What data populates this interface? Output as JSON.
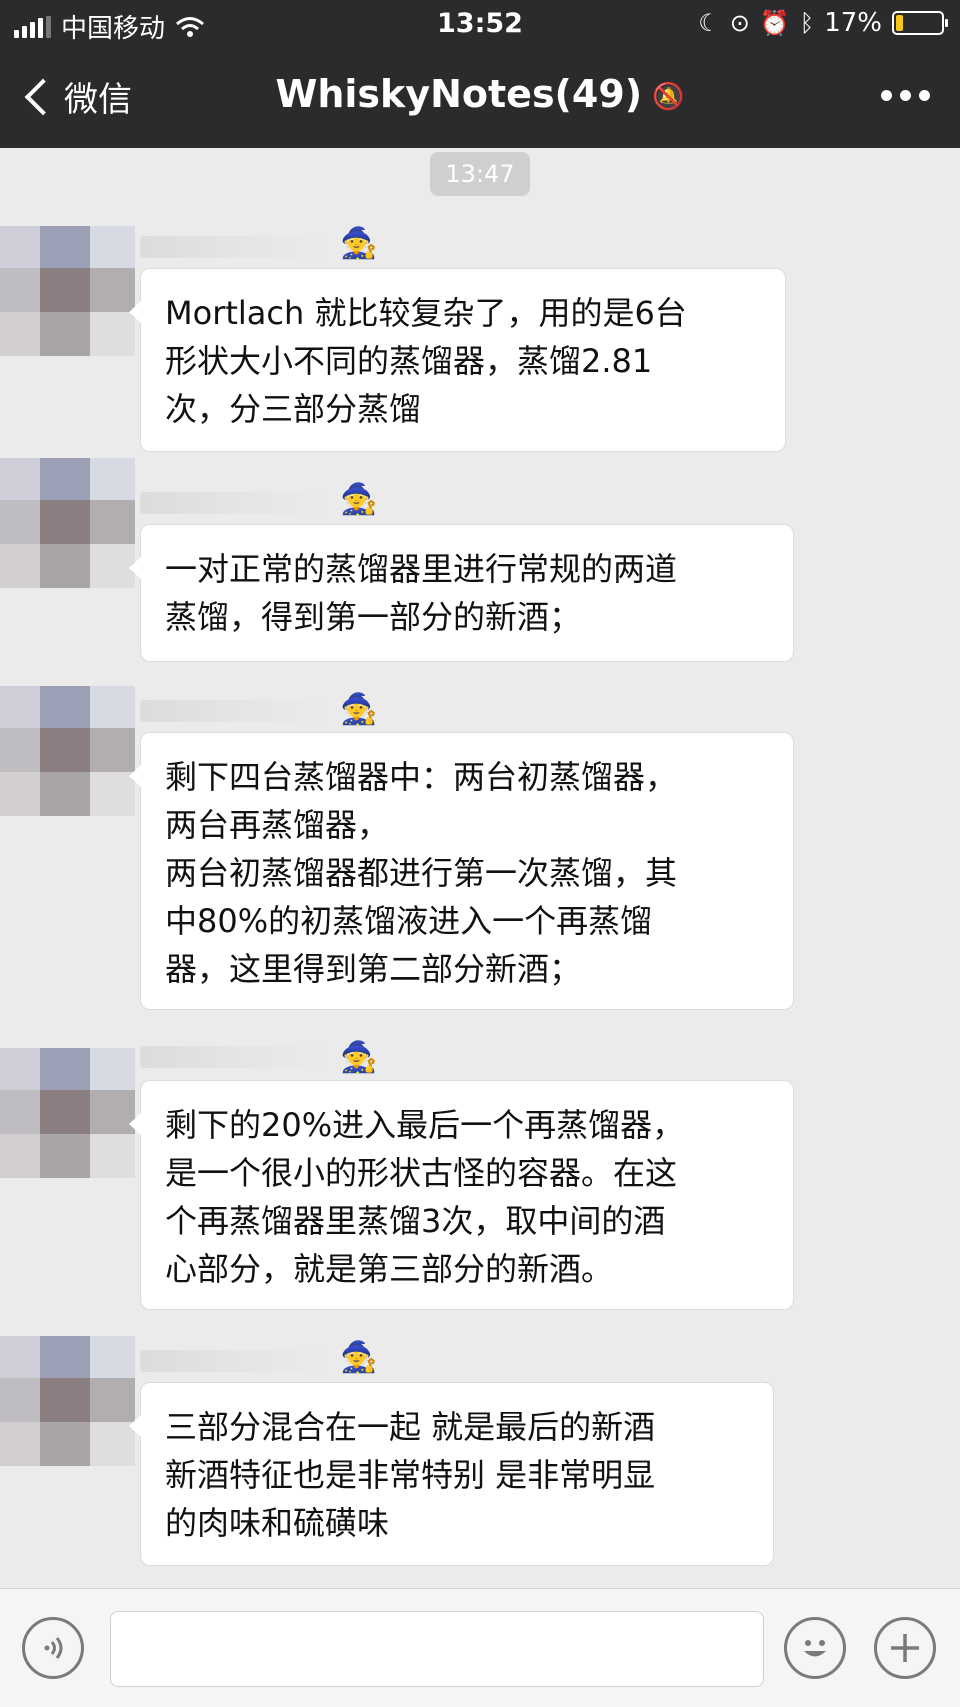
{
  "status_bar": {
    "carrier": "中国移动",
    "time": "13:52",
    "battery": "17%",
    "battery_level": 0.17
  },
  "nav": {
    "back_label": "微信",
    "title": "WhiskyNotes(49)"
  },
  "chat": {
    "timestamp": "13:47",
    "messages": [
      {
        "text": "Mortlach 就比较复杂了，用的是6台\n形状大小不同的蒸馏器，蒸馏2.81\n次，分三部分蒸馏"
      },
      {
        "text": "一对正常的蒸馏器里进行常规的两道\n蒸馏，得到第一部分的新酒；"
      },
      {
        "text": "剩下四台蒸馏器中：两台初蒸馏器，\n两台再蒸馏器，\n两台初蒸馏器都进行第一次蒸馏，其\n中80%的初蒸馏液进入一个再蒸馏\n器，这里得到第二部分新酒；"
      },
      {
        "text": "剩下的20%进入最后一个再蒸馏器，\n是一个很小的形状古怪的容器。在这\n个再蒸馏器里蒸馏3次，取中间的酒\n心部分，就是第三部分的新酒。"
      },
      {
        "text": "三部分混合在一起 就是最后的新酒\n新酒特征也是非常特别 是非常明显\n的肉味和硫磺味"
      }
    ]
  },
  "icons": {
    "voice": "voice-icon",
    "emoji": "emoji-icon",
    "plus": "plus-icon",
    "badge": "wizard-emoji-icon"
  }
}
